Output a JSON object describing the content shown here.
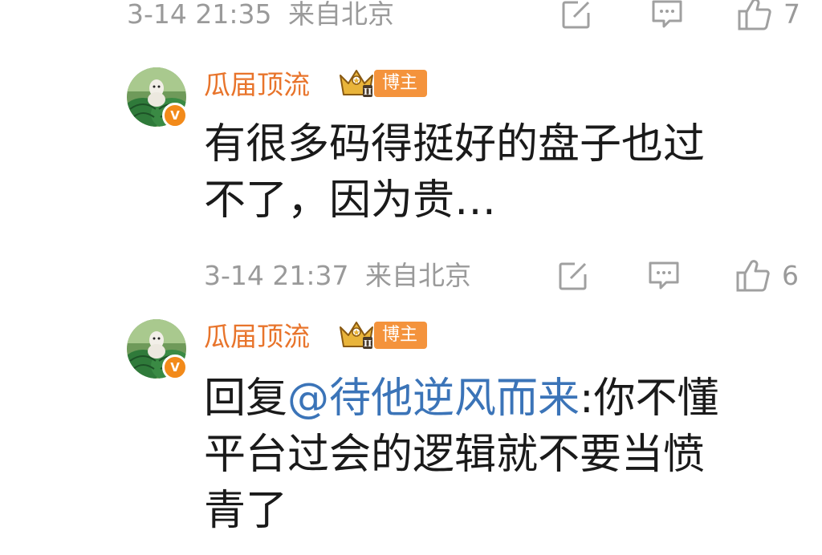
{
  "comments": [
    {
      "timestamp": "3-14 21:35",
      "location": "来自北京",
      "like_count": "7"
    },
    {
      "username": "瓜届顶流",
      "role_tag": "博主",
      "level_badge": "crown-level-2-badge",
      "body_lines": [
        "有很多码得挺好的盘子也过",
        "不了，因为贵…"
      ],
      "timestamp": "3-14 21:37",
      "location": "来自北京",
      "like_count": "6"
    },
    {
      "username": "瓜届顶流",
      "role_tag": "博主",
      "level_badge": "crown-level-2-badge",
      "reply_prefix": "回复",
      "mention": "@待他逆风而来",
      "reply_rest": ":你不懂",
      "body_lines": [
        "平台过会的逻辑就不要当愤",
        "青了"
      ]
    }
  ],
  "icons": {
    "share": "edit-share-icon",
    "reply": "comment-icon",
    "like": "thumbs-up-icon",
    "verified": "verified-v-badge"
  },
  "colors": {
    "username": "#e8742b",
    "meta_gray": "#9a9a9a",
    "mention_blue": "#3b74b8",
    "tag_orange": "#f4933c",
    "body_text": "#1a1a1a"
  }
}
